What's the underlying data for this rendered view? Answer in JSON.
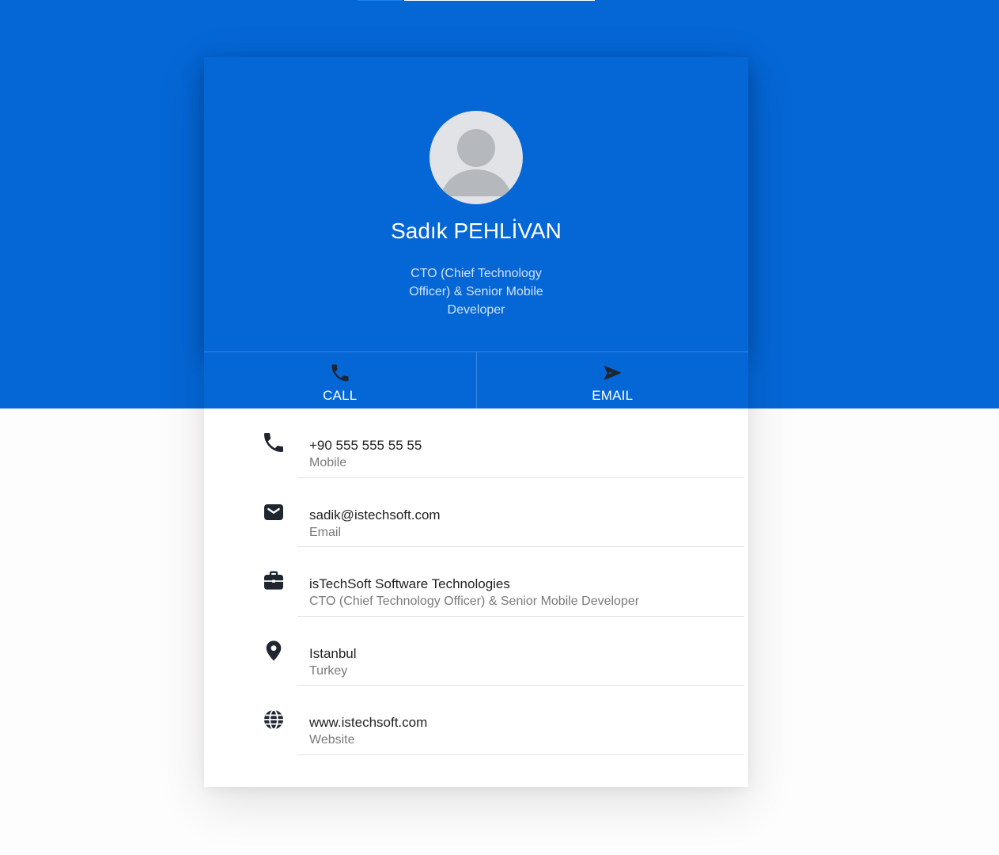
{
  "colors": {
    "brand_blue": "#0566d5",
    "card_bg": "#ffffff",
    "text_dark": "#222222",
    "text_muted": "#7a7a7a"
  },
  "profile": {
    "name": "Sadık PEHLİVAN",
    "title": "CTO (Chief Technology Officer) & Senior Mobile Developer",
    "avatar_icon": "person-placeholder-icon"
  },
  "actions": {
    "call": {
      "label": "CALL",
      "icon": "phone-icon"
    },
    "email": {
      "label": "EMAIL",
      "icon": "send-icon"
    }
  },
  "contacts": [
    {
      "icon": "phone-icon",
      "primary": "+90 555 555 55 55",
      "secondary": "Mobile"
    },
    {
      "icon": "mail-icon",
      "primary": "sadik@istechsoft.com",
      "secondary": "Email"
    },
    {
      "icon": "briefcase-icon",
      "primary": "isTechSoft Software Technologies",
      "secondary": "CTO (Chief Technology Officer) & Senior Mobile Developer"
    },
    {
      "icon": "location-pin-icon",
      "primary": "Istanbul",
      "secondary": "Turkey"
    },
    {
      "icon": "globe-icon",
      "primary": "www.istechsoft.com",
      "secondary": "Website"
    }
  ]
}
